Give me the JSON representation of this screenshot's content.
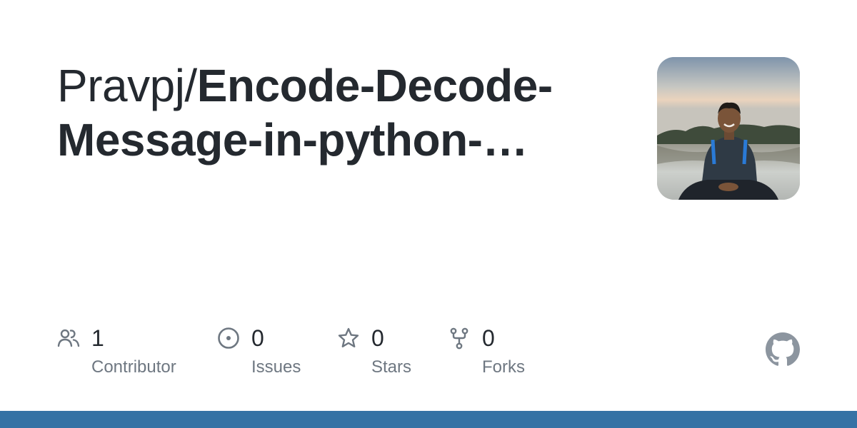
{
  "repo": {
    "owner": "Pravpj/",
    "name_line1": "Encode-Decode-",
    "name_line2": "Message-in-python-…"
  },
  "stats": {
    "contributors": {
      "value": "1",
      "label": "Contributor",
      "icon": "people-icon"
    },
    "issues": {
      "value": "0",
      "label": "Issues",
      "icon": "issue-opened-icon"
    },
    "stars": {
      "value": "0",
      "label": "Stars",
      "icon": "star-icon"
    },
    "forks": {
      "value": "0",
      "label": "Forks",
      "icon": "repo-forked-icon"
    }
  },
  "language_color": "#3572a5",
  "brand_icon": "github-mark-icon"
}
